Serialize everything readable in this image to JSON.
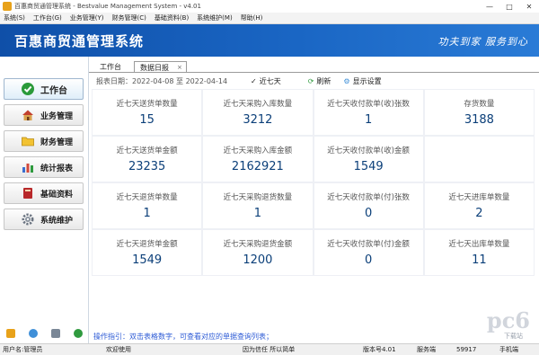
{
  "window": {
    "title": "百惠商贸通管理系统 - Bestvalue Management System - v4.01",
    "controls": [
      "—",
      "□",
      "✕"
    ]
  },
  "menu": [
    "系统(S)",
    "工作台(G)",
    "业务管理(Y)",
    "财务管理(C)",
    "基础资料(B)",
    "系统维护(M)",
    "帮助(H)"
  ],
  "banner": {
    "logo": "百惠商贸通管理系统",
    "slogan": "功夫到家  服务到心"
  },
  "sidebar": {
    "items": [
      {
        "label": "工作台",
        "icon": "check-circle-icon",
        "active": true
      },
      {
        "label": "业务管理",
        "icon": "house-icon",
        "active": false
      },
      {
        "label": "财务管理",
        "icon": "folder-icon",
        "active": false
      },
      {
        "label": "统计报表",
        "icon": "chart-icon",
        "active": false
      },
      {
        "label": "基础资料",
        "icon": "book-icon",
        "active": false
      },
      {
        "label": "系统维护",
        "icon": "gear-icon",
        "active": false
      }
    ]
  },
  "tabs": {
    "workbench": "工作台",
    "daily_report": "数据日报",
    "close": "×"
  },
  "toolbar": {
    "date_label": "报表日期：2022-04-08 至 2022-04-14",
    "recent7": "近七天",
    "refresh": "刷新",
    "display": "显示设置"
  },
  "metrics": [
    {
      "label": "近七天送货单数量",
      "value": "15"
    },
    {
      "label": "近七天采购入库数量",
      "value": "3212"
    },
    {
      "label": "近七天收付款单(收)张数",
      "value": "1"
    },
    {
      "label": "存货数量",
      "value": "3188"
    },
    {
      "label": "近七天送货单金额",
      "value": "23235"
    },
    {
      "label": "近七天采购入库金额",
      "value": "2162921"
    },
    {
      "label": "近七天收付款单(收)金额",
      "value": "1549"
    },
    {
      "label": "",
      "value": ""
    },
    {
      "label": "近七天退货单数量",
      "value": "1"
    },
    {
      "label": "近七天采购退货数量",
      "value": "1"
    },
    {
      "label": "近七天收付款单(付)张数",
      "value": "0"
    },
    {
      "label": "近七天进库单数量",
      "value": "2"
    },
    {
      "label": "近七天退货单金额",
      "value": "1549"
    },
    {
      "label": "近七天采购退货金额",
      "value": "1200"
    },
    {
      "label": "近七天收付款单(付)金额",
      "value": "0"
    },
    {
      "label": "近七天出库单数量",
      "value": "11"
    }
  ],
  "hint": "操作指引：双击表格数字，可查看对应的单据查询列表；",
  "status": {
    "user": "用户名:管理员",
    "welcome": "欢迎使用",
    "motto": "因为信任  所以简单",
    "version": "版本号4.01",
    "server": "服务端",
    "port": "59917",
    "phone": "手机端"
  },
  "watermark": {
    "logo": "pc6",
    "sub": "下载站"
  },
  "colors": {
    "banner": "#1a66c4",
    "value": "#0b3f79",
    "hint": "#2d5bd6"
  }
}
